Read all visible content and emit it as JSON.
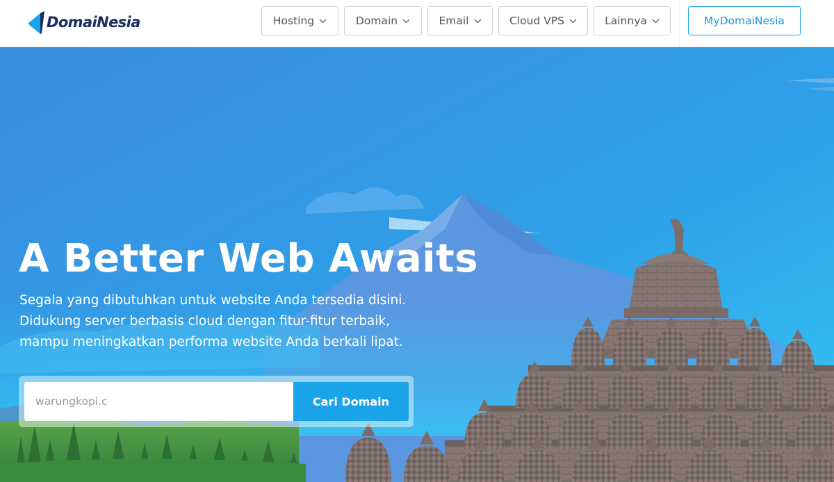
{
  "brand": {
    "name": "DomaiNesia"
  },
  "nav": {
    "items": [
      {
        "label": "Hosting"
      },
      {
        "label": "Domain"
      },
      {
        "label": "Email"
      },
      {
        "label": "Cloud VPS"
      },
      {
        "label": "Lainnya"
      }
    ],
    "account_label": "MyDomaiNesia"
  },
  "hero": {
    "title": "A Better Web Awaits",
    "description_lines": [
      "Segala yang dibutuhkan untuk website Anda tersedia disini.",
      "Didukung server berbasis cloud dengan fitur-fitur terbaik,",
      "mampu meningkatkan performa website Anda berkali lipat."
    ],
    "search": {
      "placeholder": "warungkopi.c",
      "value": "",
      "button_label": "Cari Domain"
    },
    "illustration": "Borobudur temple with blue mountains and green trees"
  },
  "colors": {
    "accent": "#1aa3e8",
    "brand_dark": "#1b2f5e",
    "sky_top": "#3d8fe0",
    "sky_bottom": "#31c0f0",
    "temple": "#857672"
  },
  "icons": {
    "logo": "domainesia-logo-mark",
    "nav_dropdown": "chevron-down-icon"
  }
}
